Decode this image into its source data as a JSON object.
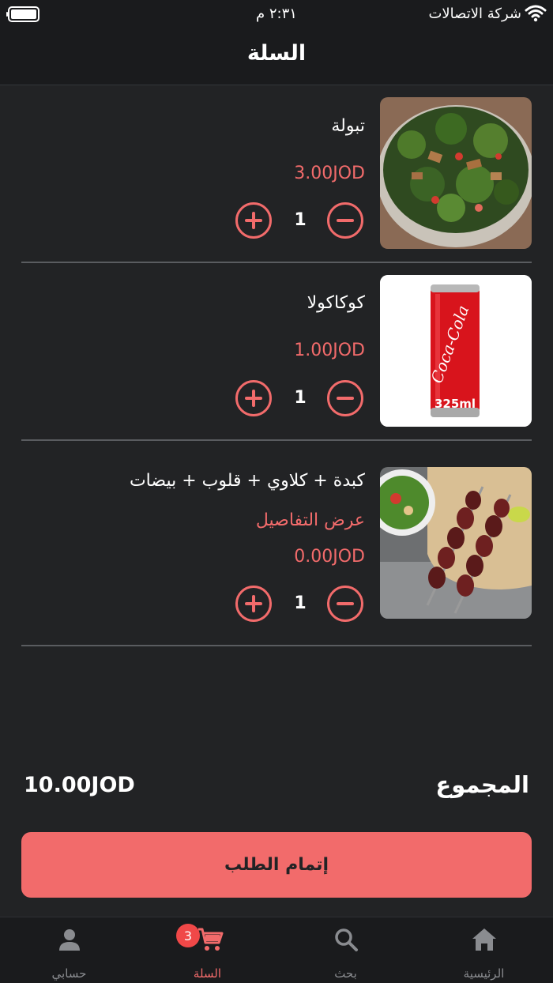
{
  "status_bar": {
    "carrier": "شركة الاتصالات",
    "time": "٢:٣١ م"
  },
  "header": {
    "title": "السلة"
  },
  "colors": {
    "accent": "#f26b6b",
    "background": "#222325",
    "bar": "#1a1b1d"
  },
  "cart": {
    "items": [
      {
        "name": "تبولة",
        "price": "3.00JOD",
        "quantity": "1",
        "image_icon": "salad-bowl-image"
      },
      {
        "name": "كوكاكولا",
        "price": "1.00JOD",
        "quantity": "1",
        "image_icon": "cola-can-image",
        "can_label": "Coca-Cola",
        "can_volume": "325ml"
      },
      {
        "name": "كبدة + كلاوي + قلوب + بيضات",
        "details_link": "عرض التفاصيل",
        "price": "0.00JOD",
        "quantity": "1",
        "image_icon": "grilled-skewers-image"
      }
    ]
  },
  "summary": {
    "total_label": "المجموع",
    "total_value": "10.00JOD"
  },
  "checkout": {
    "label": "إتمام الطلب"
  },
  "tabs": [
    {
      "label": "الرئيسية",
      "icon": "home-icon"
    },
    {
      "label": "بحث",
      "icon": "search-icon"
    },
    {
      "label": "السلة",
      "icon": "cart-icon",
      "badge": "3",
      "active": true
    },
    {
      "label": "حسابي",
      "icon": "user-icon"
    }
  ]
}
